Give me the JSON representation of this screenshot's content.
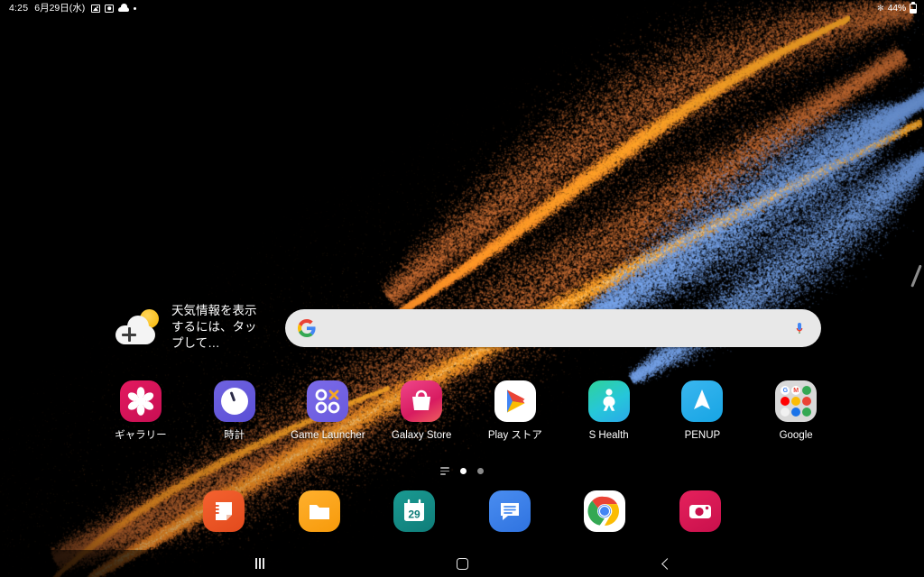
{
  "status_bar": {
    "time": "4:25",
    "date": "6月29日(水)",
    "left_icons": [
      "photo-icon",
      "screenshot-icon",
      "cloud-icon",
      "dot-icon"
    ],
    "right_icons": [
      "bluetooth-icon"
    ],
    "battery_percent": "44%",
    "battery_level": 44
  },
  "weather_widget": {
    "icon": "cloud-plus-sun-icon",
    "text": "天気情報を表示するには、タップして…"
  },
  "search": {
    "value": "",
    "placeholder": "",
    "left_icon": "google-g-icon",
    "right_icon": "microphone-icon"
  },
  "apps": [
    {
      "label": "ギャラリー",
      "icon": "gallery-icon"
    },
    {
      "label": "時計",
      "icon": "clock-icon"
    },
    {
      "label": "Game Launcher",
      "icon": "game-launcher-icon"
    },
    {
      "label": "Galaxy Store",
      "icon": "galaxy-store-icon"
    },
    {
      "label": "Play ストア",
      "icon": "play-store-icon"
    },
    {
      "label": "S Health",
      "icon": "s-health-icon"
    },
    {
      "label": "PENUP",
      "icon": "penup-icon"
    },
    {
      "label": "Google",
      "icon": "google-folder-icon"
    }
  ],
  "google_folder": {
    "mini_icons": [
      "google-icon",
      "gmail-icon",
      "maps-icon",
      "youtube-icon",
      "drive-icon",
      "chrome-red-icon",
      "keep-icon",
      "meet-icon",
      "photos-icon"
    ]
  },
  "page_indicator": {
    "home_glyph": "home-list-icon",
    "dots": [
      "active",
      "inactive"
    ]
  },
  "dock": [
    {
      "name": "samsung-notes",
      "icon": "notes-icon"
    },
    {
      "name": "my-files",
      "icon": "folder-icon"
    },
    {
      "name": "calendar",
      "icon": "calendar-icon",
      "day": "29"
    },
    {
      "name": "messages",
      "icon": "message-icon"
    },
    {
      "name": "chrome",
      "icon": "chrome-icon"
    },
    {
      "name": "camera",
      "icon": "camera-icon"
    }
  ],
  "nav_bar": {
    "recents": "recents-icon",
    "home": "home-icon",
    "back": "back-icon"
  },
  "edge_panel": {
    "handle": "edge-panel-handle"
  },
  "wallpaper": {
    "name": "particle-swirl-wallpaper",
    "background": "#000000",
    "accent_orange": "#e8931f",
    "accent_blue": "#6fa8e8"
  }
}
